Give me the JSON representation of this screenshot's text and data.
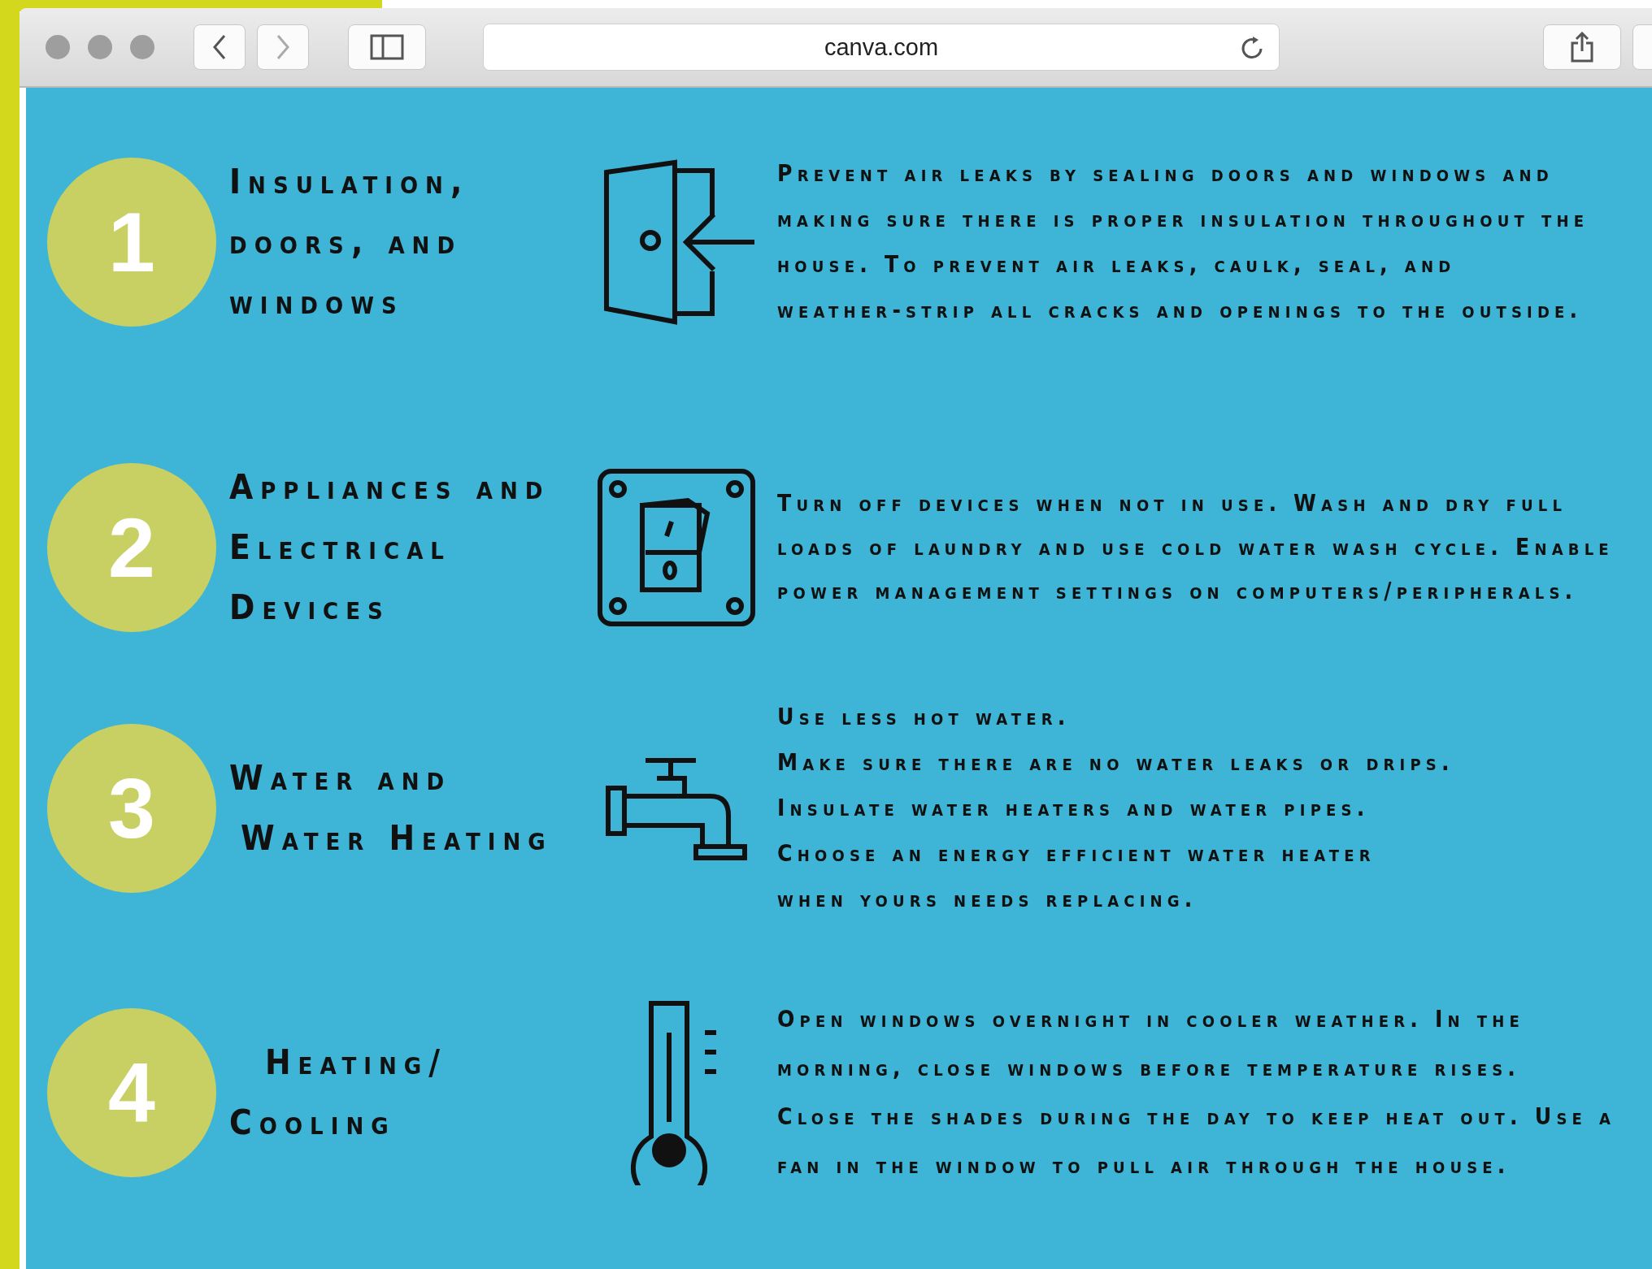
{
  "browser": {
    "url": "canva.com"
  },
  "rows": [
    {
      "number": "1",
      "title": [
        "Insulation,",
        "doors, and",
        "windows"
      ],
      "kind": "door",
      "lines": [
        "Prevent air leaks by sealing doors and windows and",
        "making sure there is proper insulation throughout the",
        "house.  To prevent air leaks, caulk, seal, and",
        "weather-strip all cracks and openings to the outside."
      ]
    },
    {
      "number": "2",
      "title": [
        "Appliances and",
        "Electrical",
        "Devices"
      ],
      "kind": "switch",
      "lines": [
        "Turn off devices when not in use. Wash and dry full",
        "loads of laundry and use cold water wash cycle. Enable",
        "power management settings on computers/peripherals."
      ]
    },
    {
      "number": "3",
      "title": [
        "Water and",
        "Water Heating"
      ],
      "kind": "faucet",
      "lines": [
        "Use less hot water.",
        "Make sure there are no water leaks or drips.",
        "Insulate water heaters and water pipes.",
        "Choose an energy efficient water heater",
        "when yours needs replacing."
      ]
    },
    {
      "number": "4",
      "title": [
        "Heating/",
        "Cooling"
      ],
      "kind": "thermometer",
      "lines": [
        "Open windows overnight in cooler weather. In the",
        "morning, close windows before temperature rises.",
        "Close the shades during the day to keep heat out. Use a",
        "fan in the window to pull air through the house."
      ]
    }
  ]
}
